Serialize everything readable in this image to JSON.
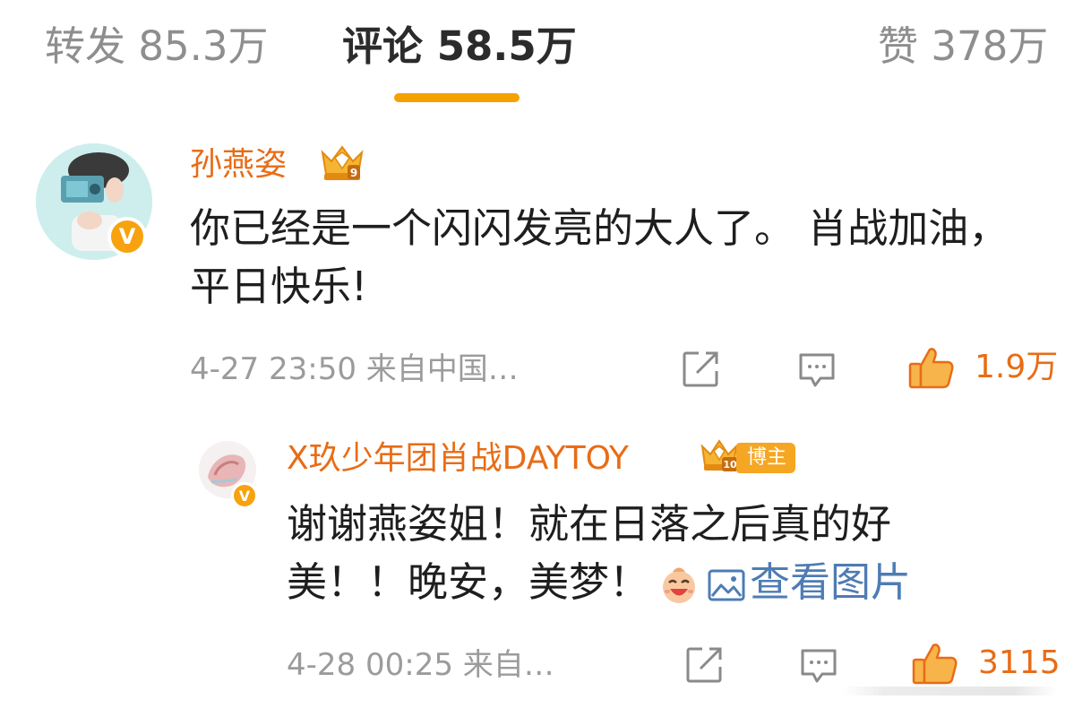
{
  "tabs": {
    "repost": {
      "label": "转发",
      "count": "85.3万"
    },
    "comment": {
      "label": "评论",
      "count": "58.5万"
    },
    "like": {
      "label": "赞",
      "count": "378万"
    }
  },
  "comment": {
    "username": "孙燕姿",
    "text": "你已经是一个闪闪发亮的大人了。 肖战加油，平日快乐!",
    "time": "4-27 23:50",
    "source": "来自中国…",
    "likes": "1.9万"
  },
  "reply": {
    "username": "X玖少年团肖战DAYTOY",
    "tag": "博主",
    "text": "谢谢燕姿姐！就在日落之后真的好美！！晚安，美梦！",
    "view_image": "查看图片",
    "time": "4-28 00:25",
    "source": "来自…",
    "likes": "3115"
  },
  "colors": {
    "accent": "#f5a100",
    "username": "#e86c16",
    "link": "#4e7cb4",
    "meta": "#9b9b9b"
  },
  "icons": [
    "crown-icon",
    "verified-v-icon",
    "share-icon",
    "comment-icon",
    "thumbs-up-icon",
    "image-icon",
    "laugh-emoji-icon"
  ]
}
